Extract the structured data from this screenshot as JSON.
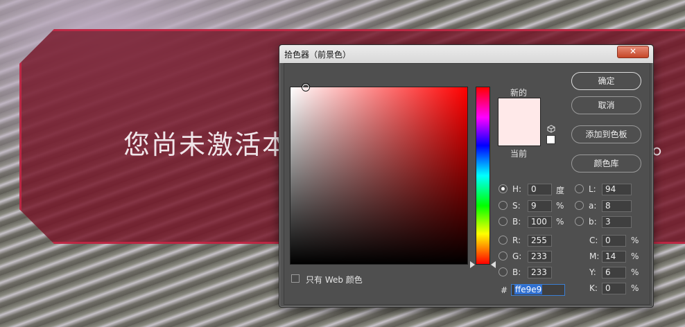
{
  "background": {
    "banner_text": "您尚未激活本",
    "banner_tail": "。"
  },
  "dialog": {
    "title": "拾色器（前景色）",
    "close_label": "✕",
    "new_label": "新的",
    "current_label": "当前",
    "new_color": "#ffe9e9",
    "buttons": {
      "ok": "确定",
      "cancel": "取消",
      "add_to_swatches": "添加到色板",
      "color_libraries": "颜色库"
    },
    "hsb": {
      "h_label": "H:",
      "h_value": "0",
      "h_unit": "度",
      "s_label": "S:",
      "s_value": "9",
      "s_unit": "%",
      "b_label": "B:",
      "b_value": "100",
      "b_unit": "%"
    },
    "lab": {
      "l_label": "L:",
      "l_value": "94",
      "a_label": "a:",
      "a_value": "8",
      "b_label": "b:",
      "b_value": "3"
    },
    "rgb": {
      "r_label": "R:",
      "r_value": "255",
      "g_label": "G:",
      "g_value": "233",
      "b_label": "B:",
      "b_value": "233"
    },
    "cmyk": {
      "c_label": "C:",
      "c_value": "0",
      "c_unit": "%",
      "m_label": "M:",
      "m_value": "14",
      "m_unit": "%",
      "y_label": "Y:",
      "y_value": "6",
      "y_unit": "%",
      "k_label": "K:",
      "k_value": "0",
      "k_unit": "%"
    },
    "hex_label": "#",
    "hex_value": "ffe9e9",
    "web_only_label": "只有 Web 颜色",
    "selected_mode": "H"
  }
}
